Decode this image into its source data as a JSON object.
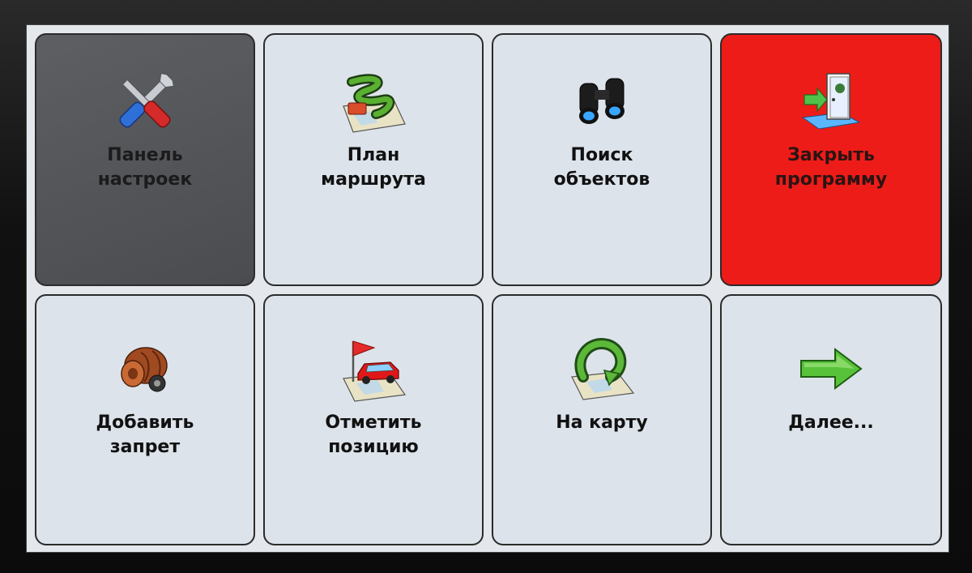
{
  "menu": {
    "tiles": [
      {
        "label": "Панель\nнастроек",
        "icon": "tools-icon"
      },
      {
        "label": "План\nмаршрута",
        "icon": "route-plan-icon"
      },
      {
        "label": "Поиск\nобъектов",
        "icon": "binoculars-icon"
      },
      {
        "label": "Закрыть\nпрограмму",
        "icon": "exit-door-icon"
      },
      {
        "label": "Добавить\nзапрет",
        "icon": "roadblock-icon"
      },
      {
        "label": "Отметить\nпозицию",
        "icon": "flag-car-icon"
      },
      {
        "label": "На карту",
        "icon": "return-to-map-icon"
      },
      {
        "label": "Далее...",
        "icon": "arrow-right-icon"
      }
    ]
  },
  "colors": {
    "tile_background": "#dde3ea",
    "selected_tile": "#4f5155",
    "close_tile": "#ee1c18",
    "screen_background": "#e4e7eb"
  }
}
